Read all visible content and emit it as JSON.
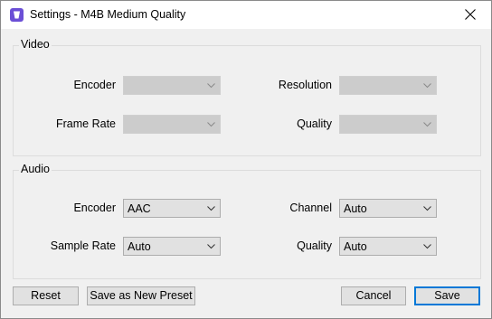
{
  "window": {
    "title": "Settings - M4B Medium Quality",
    "app_icon": "app-logo-icon",
    "close_icon": "close-icon",
    "accent_color": "#6b4fd6"
  },
  "video": {
    "group_label": "Video",
    "encoder": {
      "label": "Encoder",
      "value": "",
      "enabled": false
    },
    "resolution": {
      "label": "Resolution",
      "value": "",
      "enabled": false
    },
    "frame_rate": {
      "label": "Frame Rate",
      "value": "",
      "enabled": false
    },
    "quality": {
      "label": "Quality",
      "value": "",
      "enabled": false
    }
  },
  "audio": {
    "group_label": "Audio",
    "encoder": {
      "label": "Encoder",
      "value": "AAC"
    },
    "channel": {
      "label": "Channel",
      "value": "Auto"
    },
    "sample_rate": {
      "label": "Sample Rate",
      "value": "Auto"
    },
    "quality": {
      "label": "Quality",
      "value": "Auto"
    }
  },
  "buttons": {
    "reset": "Reset",
    "save_as_new_preset": "Save as New Preset",
    "cancel": "Cancel",
    "save": "Save"
  }
}
